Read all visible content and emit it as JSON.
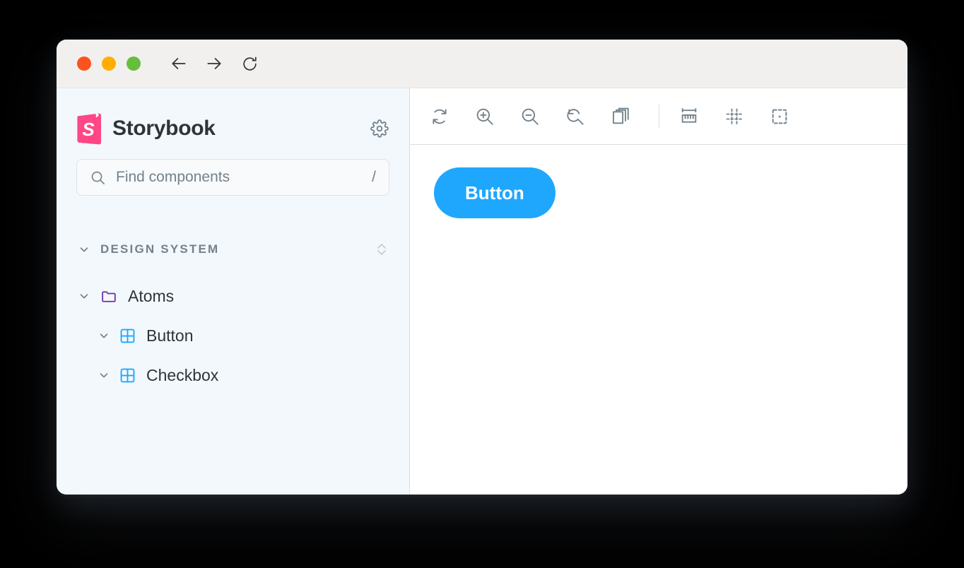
{
  "window": {
    "traffic_lights": [
      {
        "name": "close",
        "color": "#FC521F"
      },
      {
        "name": "minimize",
        "color": "#FFAE00"
      },
      {
        "name": "maximize",
        "color": "#66BF3C"
      }
    ],
    "nav": [
      {
        "name": "back-icon",
        "label": "Back"
      },
      {
        "name": "forward-icon",
        "label": "Forward"
      },
      {
        "name": "reload-icon",
        "label": "Reload"
      }
    ]
  },
  "sidebar": {
    "brand": {
      "name": "Storybook",
      "logo_color": "#FF4785",
      "settings_icon": "gear-icon"
    },
    "search": {
      "placeholder": "Find components",
      "value": "",
      "shortcut": "/",
      "icon": "search-icon"
    },
    "tree": {
      "root": {
        "label": "DESIGN SYSTEM",
        "expanded": true,
        "sort_icon": "sort-chevrons-icon"
      },
      "folder": {
        "label": "Atoms",
        "icon": "folder-icon",
        "icon_color": "#6F2CAC",
        "expanded": true
      },
      "components": [
        {
          "label": "Button",
          "icon": "component-grid-icon",
          "icon_color": "#1EA7FD",
          "expanded": true
        },
        {
          "label": "Checkbox",
          "icon": "component-grid-icon",
          "icon_color": "#1EA7FD",
          "expanded": true
        }
      ]
    }
  },
  "preview": {
    "toolbar": {
      "left_tools": [
        {
          "name": "remount-icon",
          "label": "Remount component"
        },
        {
          "name": "zoom-in-icon",
          "label": "Zoom in"
        },
        {
          "name": "zoom-out-icon",
          "label": "Zoom out"
        },
        {
          "name": "zoom-reset-icon",
          "label": "Reset zoom"
        },
        {
          "name": "background-icon",
          "label": "Change background"
        }
      ],
      "right_tools": [
        {
          "name": "measure-icon",
          "label": "Measure"
        },
        {
          "name": "grid-icon",
          "label": "Grid"
        },
        {
          "name": "outline-icon",
          "label": "Outline"
        }
      ]
    },
    "story": {
      "button_label": "Button",
      "button_color": "#1EA7FD",
      "button_text_color": "#FFFFFF"
    }
  }
}
